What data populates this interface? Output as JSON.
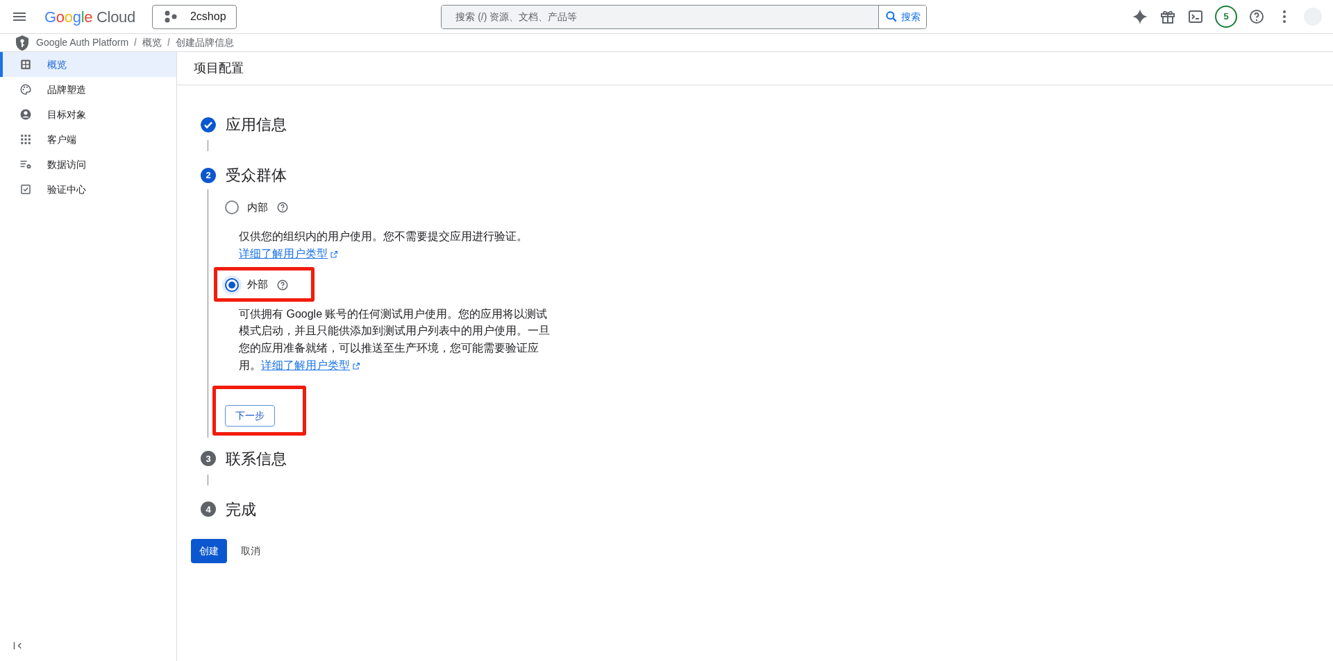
{
  "topbar": {
    "logo": "Google Cloud",
    "project": "2cshop",
    "search": {
      "placeholder": "搜索 (/) 资源、文档、产品等",
      "button": "搜索"
    },
    "badge_count": "5"
  },
  "breadcrumb": [
    {
      "kind": "link",
      "text": "Google Auth Platform"
    },
    {
      "kind": "separator",
      "text": "/"
    },
    {
      "kind": "link",
      "text": "概览"
    },
    {
      "kind": "separator",
      "text": "/"
    },
    {
      "kind": "link",
      "text": "创建品牌信息"
    }
  ],
  "sidebar": {
    "items": [
      {
        "label": "概览",
        "selected": true
      },
      {
        "label": "品牌塑造",
        "selected": false
      },
      {
        "label": "目标对象",
        "selected": false
      },
      {
        "label": "客户端",
        "selected": false
      },
      {
        "label": "数据访问",
        "selected": false
      },
      {
        "label": "验证中心",
        "selected": false
      }
    ]
  },
  "page_title": "项目配置",
  "steps": [
    {
      "title": "应用信息",
      "completed": true,
      "current": false
    },
    {
      "number": "2",
      "title": "受众群体",
      "completed": false,
      "current": true
    },
    {
      "number": "3",
      "title": "联系信息",
      "completed": false,
      "current": false
    },
    {
      "number": "4",
      "title": "完成",
      "completed": false,
      "current": false
    }
  ],
  "audience_options": [
    {
      "label": "内部",
      "selected": false,
      "description": "仅供您的组织内的用户使用。您不需要提交应用进行验证。",
      "link": "详细了解用户类型"
    },
    {
      "label": "外部",
      "selected": true,
      "highlighted": true,
      "description": "可供拥有 Google 账号的任何测试用户使用。您的应用将以测试模式启动，并且只能供添加到测试用户列表中的用户使用。一旦您的应用准备就绪，可以推送至生产环境，您可能需要验证应用。",
      "link": "详细了解用户类型"
    }
  ],
  "next_button": {
    "label": "下一步",
    "highlighted": true
  },
  "actions": {
    "create": "创建",
    "cancel": "取消"
  }
}
